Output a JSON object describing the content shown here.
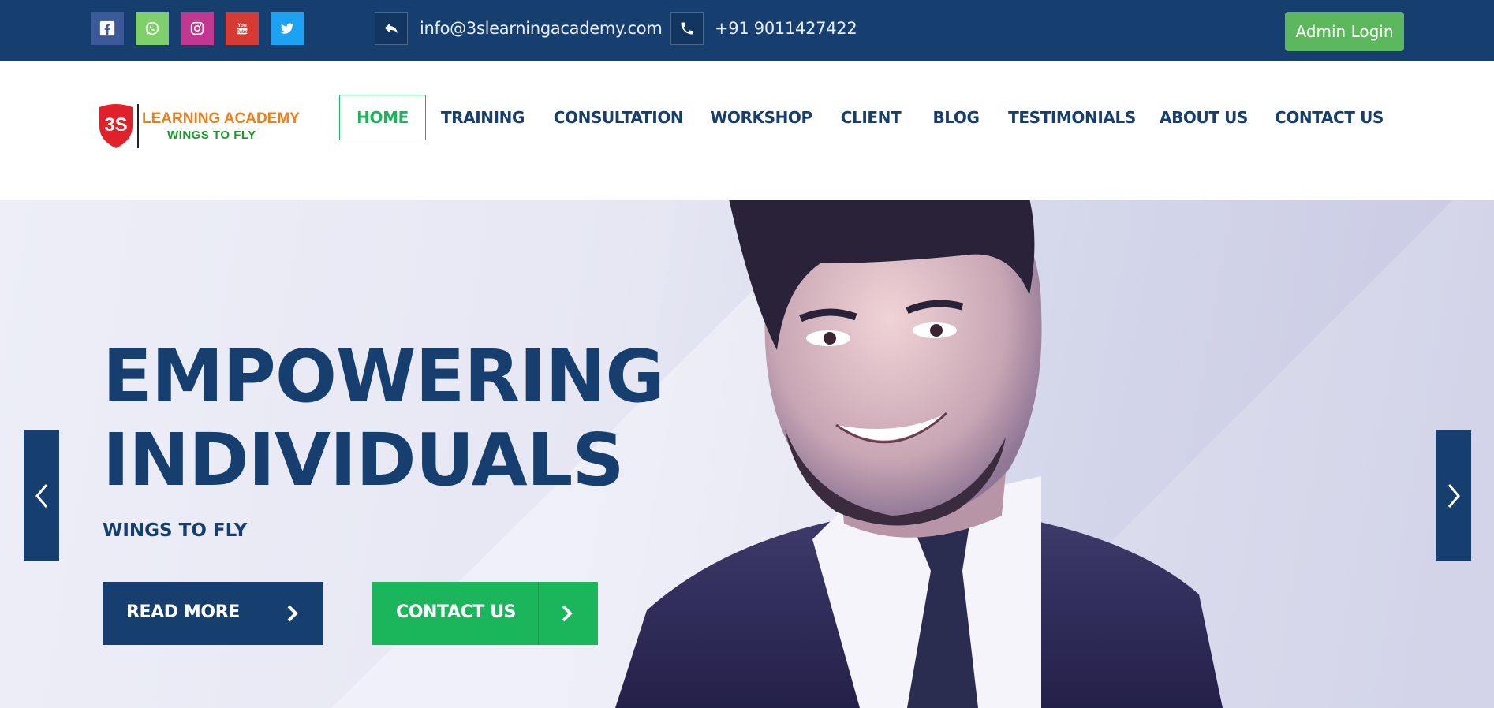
{
  "colors": {
    "primary": "#163f6f",
    "accent_green": "#1bb55c",
    "admin_green": "#5cb85c",
    "facebook": "#3b5998",
    "whatsapp": "#7fcf6d",
    "instagram": "#c2378f",
    "youtube": "#d63b33",
    "twitter": "#1da1f2",
    "logo_orange": "#f07d17",
    "logo_green": "#1a9a2c",
    "logo_red": "#e0212c"
  },
  "topbar": {
    "social_icons": [
      "facebook-icon",
      "whatsapp-icon",
      "instagram-icon",
      "youtube-icon",
      "twitter-icon"
    ],
    "email": "info@3slearningacademy.com",
    "phone": "+91 9011427422",
    "admin_login": "Admin Login"
  },
  "logo": {
    "mark": "3S",
    "line1": "LEARNING ACADEMY",
    "line2": "WINGS TO FLY"
  },
  "nav": {
    "items": [
      {
        "label": "HOME",
        "active": true
      },
      {
        "label": "TRAINING"
      },
      {
        "label": "CONSULTATION"
      },
      {
        "label": "WORKSHOP"
      },
      {
        "label": "CLIENT"
      },
      {
        "label": "BLOG"
      },
      {
        "label": "TESTIMONIALS"
      },
      {
        "label": "ABOUT US"
      },
      {
        "label": "CONTACT US"
      }
    ]
  },
  "hero": {
    "title_line1": "EMPOWERING",
    "title_line2": "INDIVIDUALS",
    "subtitle": "WINGS TO FLY",
    "read_more": "READ MORE",
    "contact_us": "CONTACT US"
  }
}
